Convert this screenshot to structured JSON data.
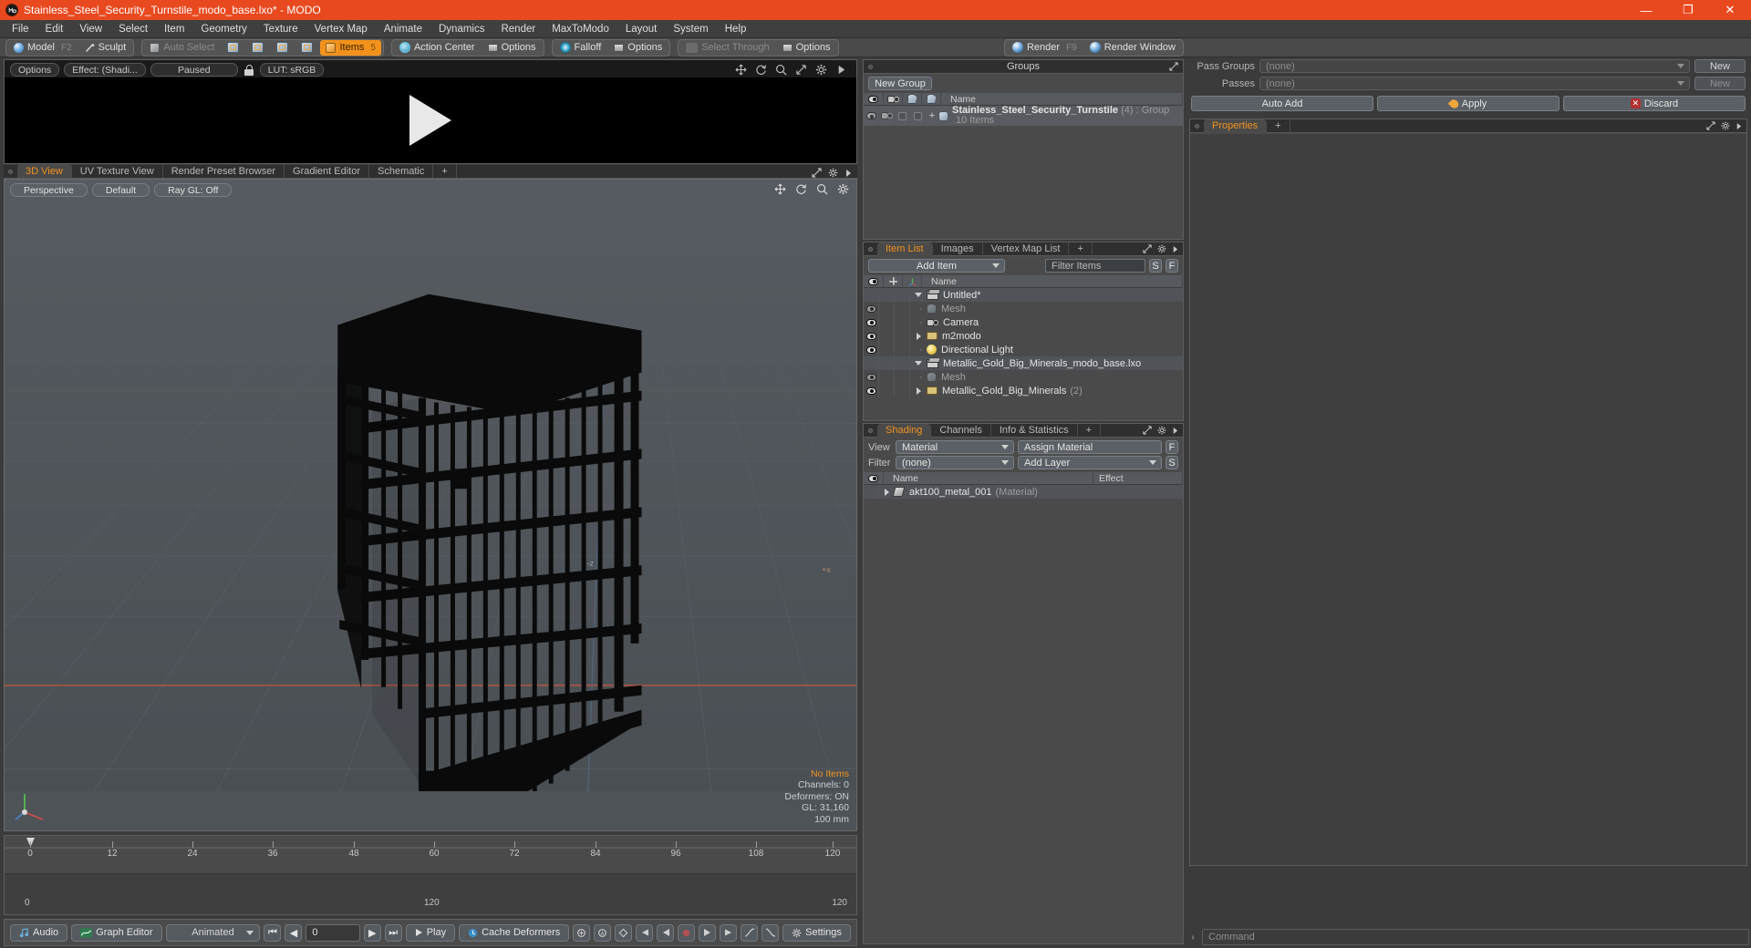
{
  "window": {
    "title": "Stainless_Steel_Security_Turnstile_modo_base.lxo* - MODO",
    "app_icon": "modo-logo-icon",
    "minimize": "—",
    "maximize": "❐",
    "close": "✕"
  },
  "menubar": {
    "items": [
      "File",
      "Edit",
      "View",
      "Select",
      "Item",
      "Geometry",
      "Texture",
      "Vertex Map",
      "Animate",
      "Dynamics",
      "Render",
      "MaxToModo",
      "Layout",
      "System",
      "Help"
    ]
  },
  "modebar": {
    "model": "Model",
    "model_key": "F2",
    "sculpt": "Sculpt",
    "auto_select": "Auto Select",
    "items": "Items",
    "items_key": "5",
    "action_center": "Action Center",
    "options1": "Options",
    "falloff": "Falloff",
    "options2": "Options",
    "select_through": "Select Through",
    "options3": "Options",
    "render": "Render",
    "render_key": "F9",
    "render_window": "Render Window"
  },
  "preview": {
    "options": "Options",
    "effect": "Effect: (Shadi...",
    "paused": "Paused",
    "lut": "LUT: sRGB",
    "lock_icon": "unlock-icon",
    "play_icon": "play-triangle-icon",
    "tool_icons": [
      "move-icon",
      "rotate-icon",
      "zoom-icon",
      "resize-icon",
      "gear-icon",
      "arrow-icon"
    ]
  },
  "viewport_tabs": {
    "tabs": [
      "3D View",
      "UV Texture View",
      "Render Preset Browser",
      "Gradient Editor",
      "Schematic"
    ],
    "selected": "3D View",
    "add": "+"
  },
  "viewport": {
    "perspective": "Perspective",
    "default": "Default",
    "raygl": "Ray GL: Off",
    "tool_icons": [
      "move-icon",
      "rotate-icon",
      "zoom-icon",
      "gear-icon"
    ],
    "axis_labels": {
      "z": "-z",
      "x": "+x"
    },
    "stats": {
      "no_items": "No Items",
      "channels": "Channels: 0",
      "deformers": "Deformers: ON",
      "gl": "GL: 31,160",
      "scale": "100 mm"
    }
  },
  "timeline": {
    "ticks": [
      0,
      12,
      24,
      36,
      48,
      60,
      72,
      84,
      96,
      108,
      120
    ],
    "range_start": "0",
    "range_mid": "120",
    "range_end": "120",
    "playhead_frame": "0"
  },
  "bottombar": {
    "audio": "Audio",
    "graph_editor": "Graph Editor",
    "animated": "Animated",
    "frame_value": "0",
    "play": "Play",
    "cache_deformers": "Cache Deformers",
    "settings": "Settings",
    "transport": {
      "first": "⏮",
      "prev": "◀",
      "next": "▶",
      "last": "⏭"
    }
  },
  "groups_panel": {
    "title": "Groups",
    "new_group_button": "New Group",
    "columns": [
      "eye-column",
      "camera-column",
      "shade-column",
      "render-column",
      "Name"
    ],
    "rows": [
      {
        "name": "Stainless_Steel_Security_Turnstile",
        "count": "(4)",
        "type": ": Group",
        "sub": "10 Items",
        "expander": "+",
        "icon": "gem-icon"
      }
    ]
  },
  "item_list": {
    "tabs": [
      "Item List",
      "Images",
      "Vertex Map List"
    ],
    "selected": "Item List",
    "add": "+",
    "add_item": "Add Item",
    "filter_placeholder": "Filter Items",
    "filter_s": "S",
    "filter_f": "F",
    "columns": [
      "eye-column",
      "lock-column",
      "transform-column",
      "Name"
    ],
    "rows": [
      {
        "label": "Untitled*",
        "icon": "scene-icon",
        "indent": 0,
        "expander": "down",
        "dim": false,
        "eye": false
      },
      {
        "label": "Mesh",
        "icon": "gem-icon",
        "indent": 1,
        "expander": "dot",
        "dim": true,
        "eye": true
      },
      {
        "label": "Camera",
        "icon": "camera-icon",
        "indent": 1,
        "expander": "dot",
        "dim": false,
        "eye": true
      },
      {
        "label": "m2modo",
        "icon": "folder-icon",
        "indent": 1,
        "expander": "right",
        "dim": false,
        "eye": true
      },
      {
        "label": "Directional Light",
        "icon": "light-icon",
        "indent": 1,
        "expander": "dot",
        "dim": false,
        "eye": true
      },
      {
        "label": "Metallic_Gold_Big_Minerals_modo_base.lxo",
        "icon": "scene-icon",
        "indent": 0,
        "expander": "down",
        "dim": false,
        "eye": false
      },
      {
        "label": "Mesh",
        "icon": "gem-icon",
        "indent": 1,
        "expander": "dot",
        "dim": true,
        "eye": true
      },
      {
        "label": "Metallic_Gold_Big_Minerals",
        "count": "(2)",
        "icon": "folder-icon",
        "indent": 1,
        "expander": "right",
        "dim": false,
        "eye": true
      }
    ]
  },
  "shading_panel": {
    "tabs": [
      "Shading",
      "Channels",
      "Info & Statistics"
    ],
    "selected": "Shading",
    "add": "+",
    "view_label": "View",
    "view_value": "Material",
    "assign_material": "Assign Material",
    "assign_f": "F",
    "filter_label": "Filter",
    "filter_value": "(none)",
    "add_layer": "Add Layer",
    "add_layer_s": "S",
    "columns": [
      "eye-column",
      "Name",
      "Effect"
    ],
    "rows": [
      {
        "name": "akt100_metal_001",
        "type": "(Material)",
        "effect": ""
      }
    ]
  },
  "properties_panel": {
    "pass_groups_label": "Pass Groups",
    "pass_groups_value": "(none)",
    "pass_groups_new": "New",
    "passes_label": "Passes",
    "passes_value": "(none)",
    "passes_new": "New",
    "auto_add": "Auto Add",
    "apply": "Apply",
    "discard": "Discard",
    "tab_properties": "Properties",
    "tab_add": "+"
  },
  "command_bar": {
    "placeholder": "Command",
    "arrow": "›"
  },
  "colors": {
    "title_bar": "#e8491f",
    "accent": "#f2921c",
    "panel_bg": "#4a4a4a",
    "viewport_bg": "#4e5358",
    "app_bg": "#3b3b3b"
  }
}
